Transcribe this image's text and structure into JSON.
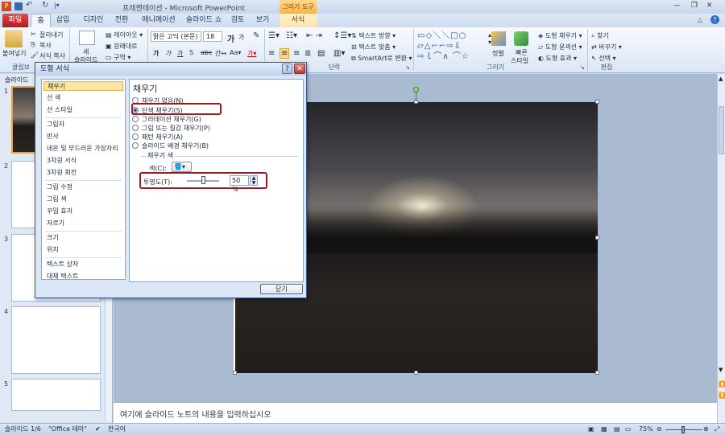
{
  "window": {
    "title": "프레젠테이션 - Microsoft PowerPoint",
    "context_tab_group": "그리기 도구"
  },
  "tabs": {
    "file": "파일",
    "home": "홈",
    "insert": "삽입",
    "design": "디자인",
    "transitions": "전환",
    "animations": "애니메이션",
    "slideshow": "슬라이드 쇼",
    "review": "검토",
    "view": "보기",
    "format": "서식"
  },
  "ribbon": {
    "clipboard": {
      "paste": "붙여넣기",
      "cut": "잘라내기",
      "copy": "복사",
      "format_painter": "서식 복사",
      "label": "클립보"
    },
    "slides": {
      "new_slide": "새",
      "new_slide2": "슬라이드",
      "layout": "레이아웃",
      "reset": "원래대로",
      "section": "구역"
    },
    "font": {
      "name": "맑은 고딕 (본문)",
      "size": "18",
      "grow": "가",
      "shrink": "가"
    },
    "paragraph": {
      "label": "단락",
      "text_direction": "텍스트 방향",
      "align_text": "텍스트 맞춤",
      "smartart": "SmartArt로 변환"
    },
    "drawing": {
      "label": "그리기",
      "arrange": "정렬",
      "quick_styles": "빠른",
      "quick_styles2": "스타일",
      "shape_fill": "도형 채우기",
      "shape_outline": "도형 윤곽선",
      "shape_effects": "도형 효과"
    },
    "editing": {
      "label": "편집",
      "find": "찾기",
      "replace": "바꾸기",
      "select": "선택"
    }
  },
  "slides_pane": {
    "tab_label": "슬라이드",
    "numbers": [
      "1",
      "2",
      "3",
      "4",
      "5"
    ]
  },
  "notes": {
    "placeholder": "여기에 슬라이드 노트의 내용을 입력하십시오"
  },
  "status": {
    "slide": "슬라이드 1/6",
    "theme": "\"Office 테마\"",
    "language": "한국어",
    "zoom": "75%"
  },
  "dialog": {
    "title": "도형 서식",
    "help": "?",
    "close_x": "✕",
    "categories": [
      "채우기",
      "선 색",
      "선 스타일",
      "그림자",
      "반사",
      "네온 및 부드러운 가장자리",
      "3차원 서식",
      "3차원 회전",
      "그림 수정",
      "그림 색",
      "꾸밈 효과",
      "자르기",
      "크기",
      "위치",
      "텍스트 상자",
      "대체 텍스트"
    ],
    "fill": {
      "heading": "채우기",
      "options": [
        "채우기 없음(N)",
        "단색 채우기(S)",
        "그라데이션 채우기(G)",
        "그림 또는 질감 채우기(P)",
        "패턴 채우기(A)",
        "슬라이드 배경 채우기(B)"
      ],
      "selected_index": 1,
      "color_section": "채우기 색",
      "color_label": "색(C):",
      "transparency_label": "투명도(T):",
      "transparency_value": "50 %",
      "transparency_fraction": 0.5
    },
    "close_button": "닫기"
  },
  "colors": {
    "file_tab": "#c62828",
    "highlight": "#9c1b22",
    "selection": "#fbe5a3"
  }
}
